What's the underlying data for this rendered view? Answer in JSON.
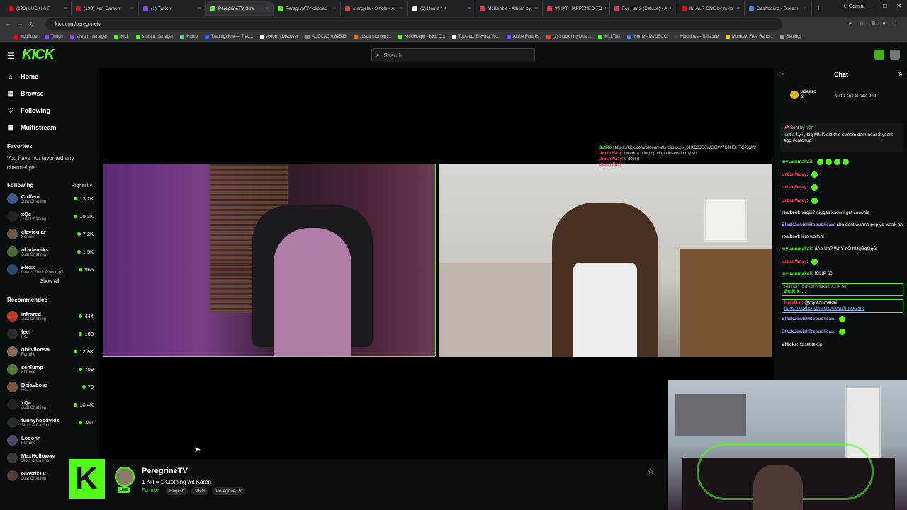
{
  "browser": {
    "tabs": [
      {
        "label": "(198) LUCKI & F",
        "color": "#ff0000"
      },
      {
        "label": "(198) Ken Carson",
        "color": "#ff0000"
      },
      {
        "label": "(1) Twitch",
        "color": "#9146ff"
      },
      {
        "label": "PeregrineTV Stre",
        "color": "#53fc18",
        "active": true
      },
      {
        "label": "PeregrineTV clipped",
        "color": "#53fc18"
      },
      {
        "label": "margiela - Single - A",
        "color": "#fa2d48"
      },
      {
        "label": "(1) Home / X",
        "color": "#ffffff"
      },
      {
        "label": "McKenzie - Album by",
        "color": "#fa2d48"
      },
      {
        "label": "WHAT HAPPENED TO",
        "color": "#fa2d48"
      },
      {
        "label": "For Her 2 (Deluxe) - A",
        "color": "#fa2d48"
      },
      {
        "label": "IM ALR ONE by mylo",
        "color": "#ff0000"
      },
      {
        "label": "Dashboard - Stream",
        "color": "#4285f4"
      }
    ],
    "gemini_label": "Gemini",
    "url": "kick.com/peregrinetv",
    "bookmarks": [
      {
        "label": "YouTube",
        "color": "#ff0000"
      },
      {
        "label": "Twitch",
        "color": "#9146ff"
      },
      {
        "label": "stream manager",
        "color": "#9146ff"
      },
      {
        "label": "Kick",
        "color": "#53fc18"
      },
      {
        "label": "stream manager",
        "color": "#53fc18"
      },
      {
        "label": "Pump",
        "color": "#5cd08a"
      },
      {
        "label": "TradingView — Trac...",
        "color": "#2962ff"
      },
      {
        "label": "Axiom | Discover",
        "color": "#ffffff"
      },
      {
        "label": "AUDCAD 0.89596",
        "color": "#888888"
      },
      {
        "label": "Just a moment...",
        "color": "#f38020"
      },
      {
        "label": "Kicklet.app - Kick C...",
        "color": "#53fc18"
      },
      {
        "label": "Topstep: Elevate Yo...",
        "color": "#ffffff"
      },
      {
        "label": "Alpha Futures",
        "color": "#6b5bff"
      },
      {
        "label": "(1) Inbox | mylenai...",
        "color": "#ea4335"
      },
      {
        "label": "KickTalk",
        "color": "#53fc18"
      },
      {
        "label": "Home - My JSCC",
        "color": "#4285f4"
      },
      {
        "label": "Machines - Tailscale",
        "color": "#444444"
      },
      {
        "label": "Monkey: Free Rand...",
        "color": "#ffcc00"
      },
      {
        "label": "Settings",
        "color": "#9aa0a6"
      }
    ]
  },
  "header": {
    "logo": "KICK",
    "search_placeholder": "Search"
  },
  "sidebar": {
    "nav": [
      {
        "label": "Home",
        "icon": "home-icon",
        "glyph": "⌂"
      },
      {
        "label": "Browse",
        "icon": "browse-icon",
        "glyph": "▤"
      },
      {
        "label": "Following",
        "icon": "heart-icon",
        "glyph": "♡"
      },
      {
        "label": "Multistream",
        "icon": "multistream-icon",
        "glyph": "▦"
      }
    ],
    "favorites_title": "Favorites",
    "favorites_empty": "You have not favorited any channel yet.",
    "following_title": "Following",
    "following_sort": "Highest",
    "following": [
      {
        "name": "Cuffem",
        "category": "Just Chatting",
        "viewers": "13.2K",
        "color": "#3b5b8a"
      },
      {
        "name": "xQc",
        "category": "Just Chatting",
        "viewers": "10.3K",
        "color": "#222222"
      },
      {
        "name": "clavicular",
        "category": "Fortnite",
        "viewers": "7.2K",
        "color": "#6f5a4a"
      },
      {
        "name": "akademiks",
        "category": "Just Chatting",
        "viewers": "1.5K",
        "color": "#4a6a3a"
      },
      {
        "name": "Flexx",
        "category": "Grand Theft Auto V (G...",
        "viewers": "965",
        "color": "#2a4a6a"
      }
    ],
    "show_all": "Show All",
    "recommended_title": "Recommended",
    "recommended": [
      {
        "name": "infrared",
        "category": "Just Chatting",
        "viewers": "444",
        "color": "#c0392b"
      },
      {
        "name": "feef",
        "category": "IRL",
        "viewers": "108",
        "color": "#2c2c2c"
      },
      {
        "name": "obliviionsw",
        "category": "Fortnite",
        "viewers": "12.9K",
        "color": "#8a6a5a"
      },
      {
        "name": "schlump",
        "category": "Fortnite",
        "viewers": "709",
        "color": "#5a7a3a"
      },
      {
        "name": "Dejayboss",
        "category": "IRL",
        "viewers": "79",
        "color": "#7a5a3a"
      },
      {
        "name": "xQc",
        "category": "Just Chatting",
        "viewers": "10.4K",
        "color": "#222222"
      },
      {
        "name": "funnyhoodvidz",
        "category": "Slots & Casino",
        "viewers": "351",
        "color": "#2a2a2a"
      },
      {
        "name": "Looonn",
        "category": "Fortnite",
        "viewers": "",
        "color": "#4a4a6a"
      },
      {
        "name": "MaxHolloway",
        "category": "Slots & Casino",
        "viewers": "",
        "color": "#3a3a3a"
      },
      {
        "name": "GlostikTV",
        "category": "Just Chatting",
        "viewers": "",
        "color": "#5a3a3a"
      }
    ]
  },
  "overlay_chat": [
    {
      "user": "BotRix",
      "text": "https://kick.com/peregrinetv/clips/clip_01KC8JD0WG0KV7K4HSHTG2XW2",
      "ucolor": "#53fc18"
    },
    {
      "user": "UrbanWavy",
      "text": "i wanna bring up virgin losers in my shi",
      "ucolor": "#ff4a6a"
    },
    {
      "user": "UrbanWavy",
      "text": "u doin it",
      "ucolor": "#ff4a6a"
    },
    {
      "user": "UrbanWavy",
      "text": "",
      "ucolor": "#ff4a6a"
    }
  ],
  "stream": {
    "streamer": "PeregrineTV",
    "title": "1 Kill = 1 Clothing wit Karen",
    "category": "Fortnite",
    "tags": [
      "English",
      "PRG",
      "PeregrineTV"
    ],
    "live_badge": "LIVE"
  },
  "chat": {
    "title": "Chat",
    "gifter": "s1eezo",
    "gifter_count": "2",
    "gift_message": "Gift 1 sub to take 2nd",
    "pinned_sent_by": "Sent by",
    "pinned_user": "rr0n",
    "pinned_text": "just a f.y.i , big MMK did this stream dam near 2 years ago #catchup",
    "messages": [
      {
        "user": "mylannmakail",
        "text": "",
        "ucolor": "#53fc18",
        "emotes": 4
      },
      {
        "user": "UrbanWavy",
        "text": "",
        "ucolor": "#ff4a6a",
        "emotes": 1
      },
      {
        "user": "UrbanWavy",
        "text": "",
        "ucolor": "#ff4a6a",
        "emotes": 1
      },
      {
        "user": "UrbanWavy",
        "text": "",
        "ucolor": "#ff4a6a",
        "emotes": 1
      },
      {
        "user": "realkeef",
        "text": "virgin? niggas know I get coochie",
        "ucolor": "#ffffff",
        "emotes": 0
      },
      {
        "user": "BlackJewishRepublican",
        "text": "she dont wanna pep yo weak ahh shit gang",
        "ucolor": "#a78bff",
        "emotes": 0
      },
      {
        "user": "realkeef",
        "text": "like wallahi",
        "ucolor": "#ffffff",
        "emotes": 0
      },
      {
        "user": "mylannmakail",
        "text": "dAp Up? WhY nO hUgGgGgG",
        "ucolor": "#53fc18",
        "emotes": 0
      },
      {
        "user": "UrbanWavy",
        "text": "",
        "ucolor": "#ff4a6a",
        "emotes": 1
      },
      {
        "user": "mylannmakail",
        "text": "!CLIP 60",
        "ucolor": "#53fc18",
        "emotes": 0
      }
    ],
    "reply_label": "Replying to mylannmakail: !CLIP 60",
    "reply_user": "BotRix",
    "reply_text": "...",
    "botrix_user": "KickBot",
    "botrix_text": "@mylannmakail",
    "botrix_link": "https://kickbot.com/clip/exwp7metezxm",
    "tail": [
      {
        "user": "BlackJewishRepublican",
        "text": "",
        "ucolor": "#a78bff",
        "emotes": 1
      },
      {
        "user": "BlackJewishRepublican",
        "text": "",
        "ucolor": "#a78bff",
        "emotes": 1
      },
      {
        "user": "VNicks",
        "text": "!disableklip",
        "ucolor": "#ffffff",
        "emotes": 0
      }
    ]
  }
}
